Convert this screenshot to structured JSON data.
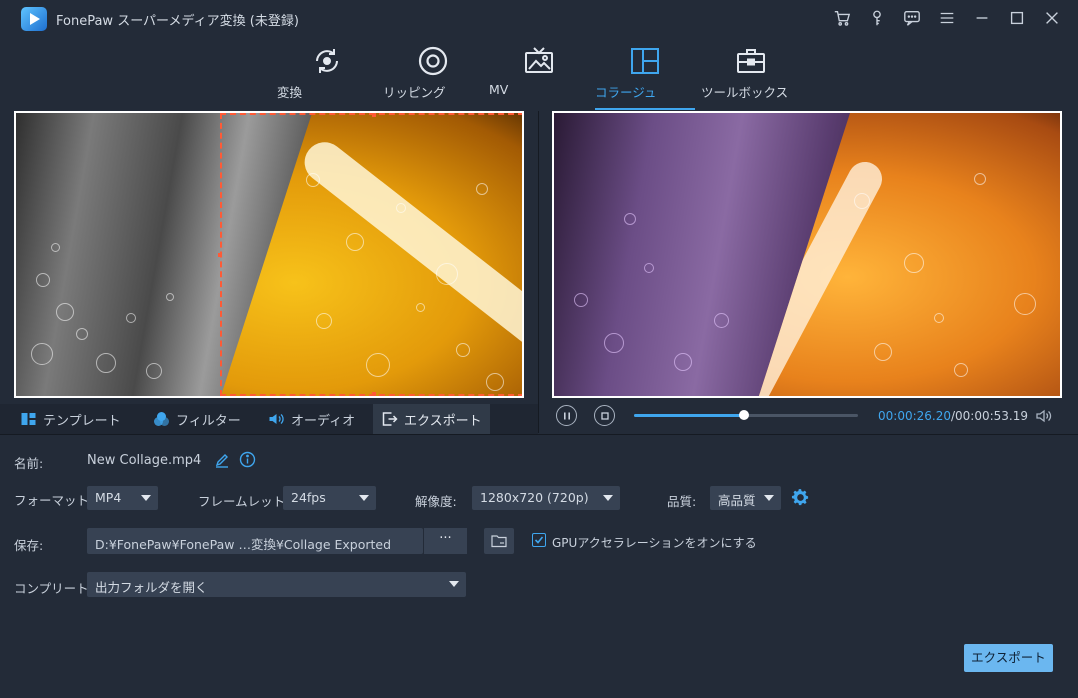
{
  "app": {
    "title": "FonePaw スーパーメディア変換 (未登録)"
  },
  "nav": {
    "tabs": [
      {
        "label": "変換"
      },
      {
        "label": "リッピング"
      },
      {
        "label": "MV"
      },
      {
        "label": "コラージュ"
      },
      {
        "label": "ツールボックス"
      }
    ],
    "active": "コラージュ"
  },
  "edit_tabs": [
    {
      "label": "テンプレート"
    },
    {
      "label": "フィルター"
    },
    {
      "label": "オーディオ"
    },
    {
      "label": "エクスポート"
    }
  ],
  "player": {
    "current": "00:00:26.20",
    "separator": "/",
    "total": "00:00:53.19",
    "progress": 0.4925
  },
  "settings": {
    "name_label": "名前:",
    "name_value": "New Collage.mp4",
    "format_label": "フォーマット:",
    "format_value": "MP4",
    "framerate_label": "フレームレット:",
    "framerate_value": "24fps",
    "resolution_label": "解像度:",
    "resolution_value": "1280x720 (720p)",
    "quality_label": "品質:",
    "quality_value": "高品質",
    "save_label": "保存:",
    "save_path": "D:¥FonePaw¥FonePaw …変換¥Collage Exported",
    "browse_label": "···",
    "gpu_label": "GPUアクセラレーションをオンにする",
    "gpu_checked": true,
    "complete_label": "コンプリート:",
    "complete_value": "出力フォルダを開く",
    "export_label": "エクスポート"
  },
  "colors": {
    "accent": "#3fa6ee",
    "background": "#232b38",
    "selection": "#ff5a36",
    "export_button": "#6bb7f0"
  }
}
